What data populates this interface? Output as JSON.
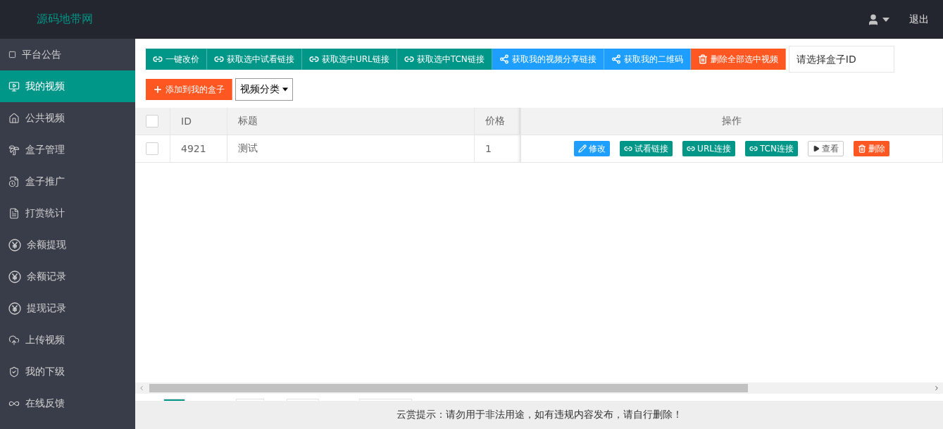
{
  "header": {
    "logo": "源码地带网",
    "logout": "退出"
  },
  "sidebar": {
    "items": [
      {
        "label": "平台公告",
        "selected": false
      },
      {
        "label": "我的视频",
        "selected": true
      },
      {
        "label": "公共视频",
        "selected": false
      },
      {
        "label": "盒子管理",
        "selected": false
      },
      {
        "label": "盒子推广",
        "selected": false
      },
      {
        "label": "打赏统计",
        "selected": false
      },
      {
        "label": "余额提现",
        "selected": false
      },
      {
        "label": "余额记录",
        "selected": false
      },
      {
        "label": "提现记录",
        "selected": false
      },
      {
        "label": "上传视频",
        "selected": false
      },
      {
        "label": "我的下级",
        "selected": false
      },
      {
        "label": "在线反馈",
        "selected": false
      }
    ]
  },
  "toolbar": {
    "buttons": [
      {
        "label": "一键改价",
        "kind": "link"
      },
      {
        "label": "获取选中试看链接",
        "kind": "link"
      },
      {
        "label": "获取选中URL链接",
        "kind": "link"
      },
      {
        "label": "获取选中TCN链接",
        "kind": "link"
      },
      {
        "label": "获取我的视频分享链接",
        "kind": "share"
      },
      {
        "label": "获取我的二维码",
        "kind": "share"
      },
      {
        "label": "删除全部选中视频",
        "kind": "delete"
      }
    ],
    "box_id": {
      "placeholder": "请选择盒子ID"
    },
    "add_button": {
      "label": "添加到我的盒子",
      "kind": "add"
    },
    "category": {
      "value": "视频分类"
    }
  },
  "table": {
    "header_checked": false,
    "columns": [
      "ID",
      "标题",
      "价格",
      "操作"
    ],
    "rows": [
      {
        "checked": false,
        "id": "4921",
        "title": "测试",
        "price": "1",
        "actions": [
          {
            "label": "修改",
            "kind": "edit"
          },
          {
            "label": "试看链接",
            "kind": "link"
          },
          {
            "label": "URL连接",
            "kind": "link"
          },
          {
            "label": "TCN连接",
            "kind": "link"
          },
          {
            "label": "查看",
            "kind": "view"
          },
          {
            "label": "删除",
            "kind": "delete"
          }
        ]
      }
    ]
  },
  "footer": {
    "notice": "云赏提示：请勿用于非法用途，如有违规内容发布，请自行删除！"
  }
}
